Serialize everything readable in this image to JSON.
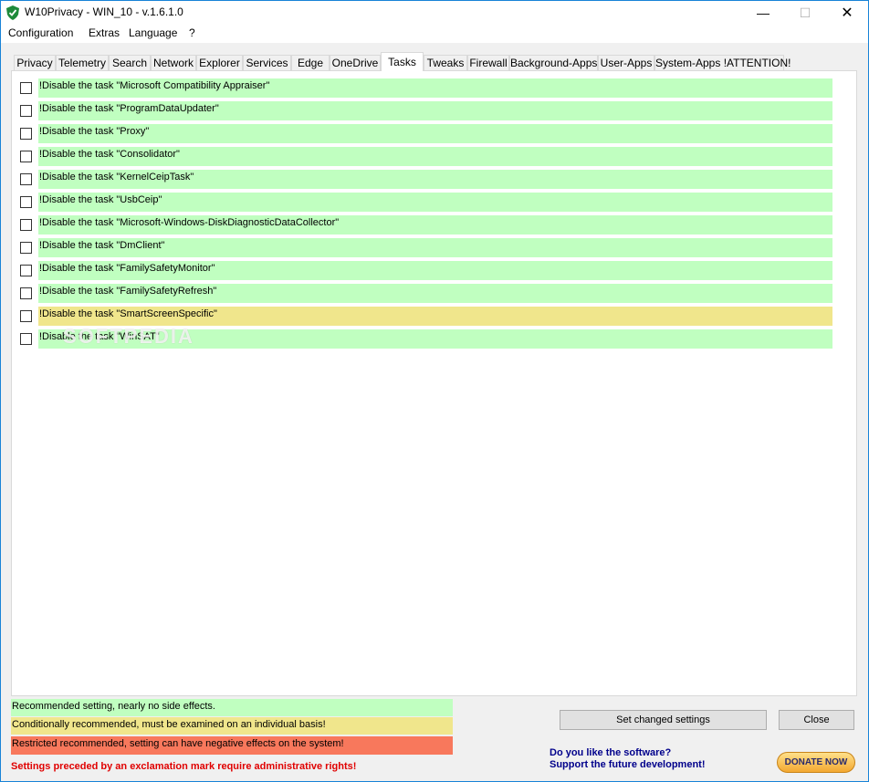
{
  "window": {
    "title": "W10Privacy - WIN_10 - v.1.6.1.0"
  },
  "controls": {
    "minimize": "—",
    "maximize": "☐",
    "close": "✕"
  },
  "menu": [
    "Configuration",
    "Extras",
    "Language",
    "?"
  ],
  "tabs": [
    "Privacy",
    "Telemetry",
    "Search",
    "Network",
    "Explorer",
    "Services",
    "Edge",
    "OneDrive",
    "Tasks",
    "Tweaks",
    "Firewall",
    "Background-Apps",
    "User-Apps",
    "System-Apps !ATTENTION!"
  ],
  "active_tab": "Tasks",
  "tasks": [
    {
      "label": "!Disable the task \"Microsoft Compatibility Appraiser\"",
      "level": "green",
      "checked": false
    },
    {
      "label": "!Disable the task \"ProgramDataUpdater\"",
      "level": "green",
      "checked": false
    },
    {
      "label": "!Disable the task \"Proxy\"",
      "level": "green",
      "checked": false
    },
    {
      "label": "!Disable the task \"Consolidator\"",
      "level": "green",
      "checked": false
    },
    {
      "label": "!Disable the task \"KernelCeipTask\"",
      "level": "green",
      "checked": false
    },
    {
      "label": "!Disable the task \"UsbCeip\"",
      "level": "green",
      "checked": false
    },
    {
      "label": "!Disable the task \"Microsoft-Windows-DiskDiagnosticDataCollector\"",
      "level": "green",
      "checked": false
    },
    {
      "label": "!Disable the task \"DmClient\"",
      "level": "green",
      "checked": false
    },
    {
      "label": "!Disable the task \"FamilySafetyMonitor\"",
      "level": "green",
      "checked": false
    },
    {
      "label": "!Disable the task \"FamilySafetyRefresh\"",
      "level": "green",
      "checked": false
    },
    {
      "label": "!Disable the task \"SmartScreenSpecific\"",
      "level": "yellow",
      "checked": false
    },
    {
      "label": "!Disable the task \"WinSAT\"",
      "level": "green",
      "checked": false
    }
  ],
  "watermark": "SOFTPEDIA",
  "legend": {
    "green": "Recommended setting, nearly no side effects.",
    "yellow": "Conditionally recommended, must be examined on an individual basis!",
    "red": "Restricted recommended, setting can have negative effects on the system!"
  },
  "admin_note": "Settings preceded by an exclamation mark require administrative rights!",
  "buttons": {
    "set_changed": "Set changed settings",
    "close": "Close"
  },
  "donate": {
    "line1": "Do you like the software?",
    "line2": "Support the future development!",
    "button": "DONATE NOW"
  },
  "colors": {
    "green": "#c0ffc0",
    "yellow": "#f0e68c",
    "red": "#f8785c",
    "accent": "#1883d7"
  }
}
